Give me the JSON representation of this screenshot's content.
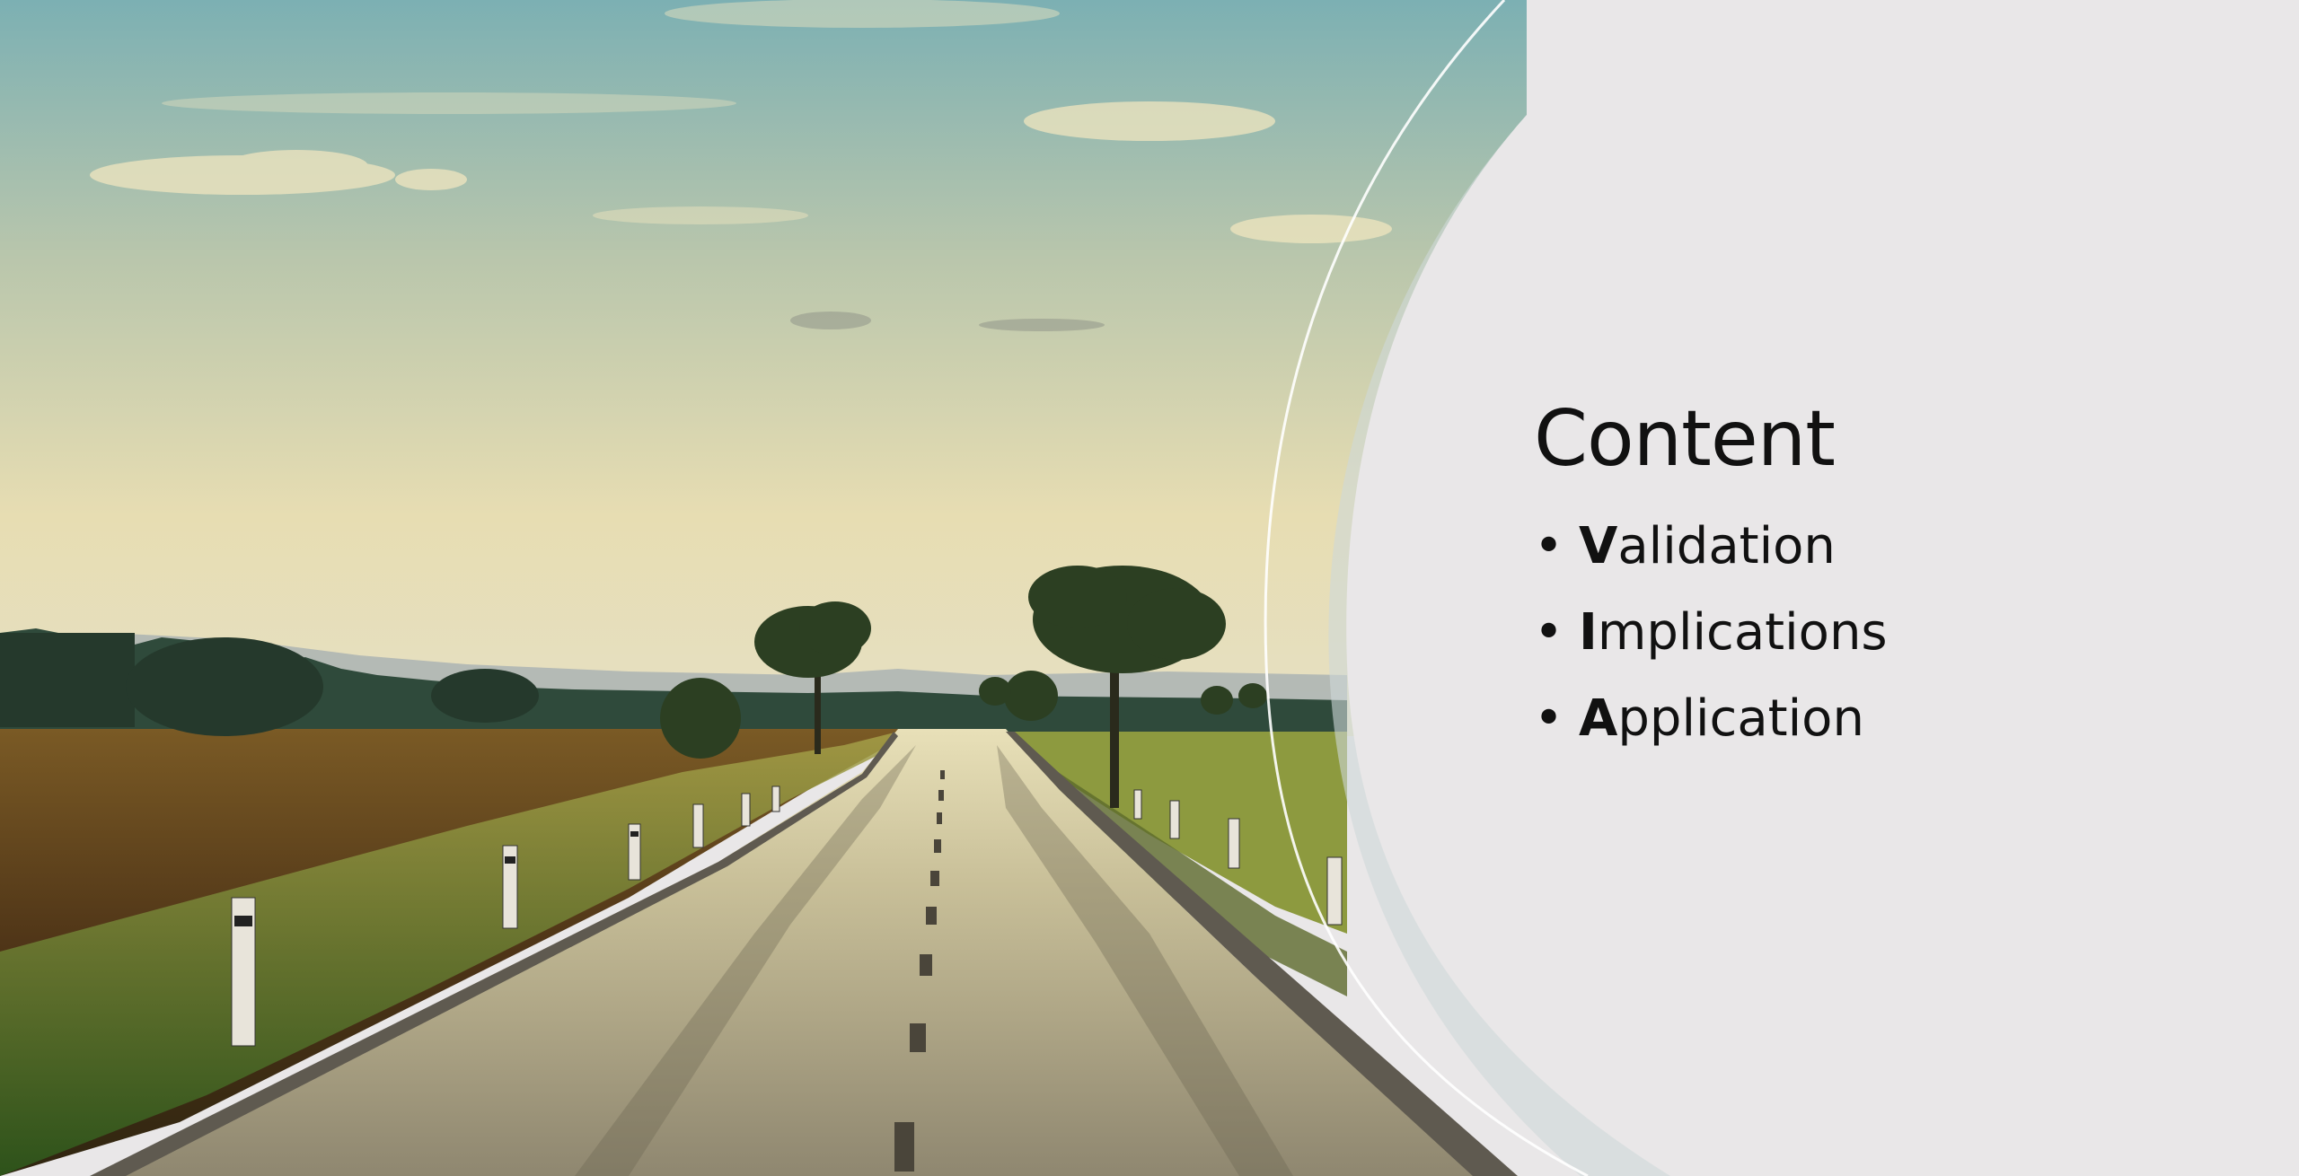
{
  "slide": {
    "title": "Content",
    "bullets": [
      {
        "initial": "V",
        "rest": "alidation"
      },
      {
        "initial": "I",
        "rest": "mplications"
      },
      {
        "initial": "A",
        "rest": "pplication"
      }
    ]
  },
  "colors": {
    "panel": "#e9e7e8",
    "sky_top": "#7fb1b4",
    "sky_bottom": "#e6dcb0",
    "field": "#5c3e1c",
    "road": "#9a9278",
    "grass": "#4f7a2a",
    "text": "#111111"
  },
  "icons": [
    "bullet-dot"
  ]
}
